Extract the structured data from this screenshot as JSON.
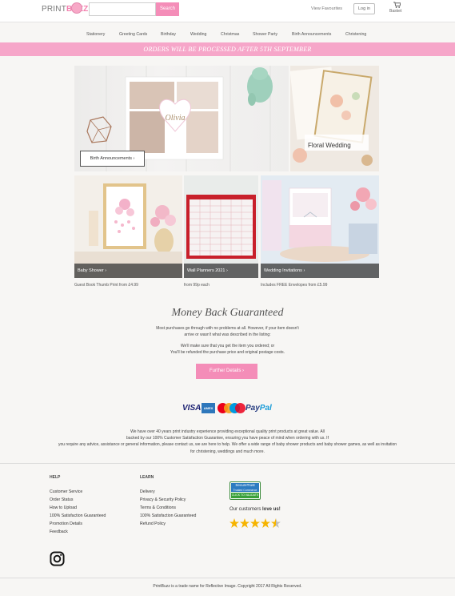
{
  "header": {
    "logo_print": "PRINT",
    "logo_buzz": "BUZZ",
    "search_placeholder": "",
    "search_button": "Search",
    "view_favourites": "View Favourites",
    "login": "Log in",
    "basket": "Basket",
    "basket_icon": "cart-icon"
  },
  "nav": {
    "items": [
      "Stationery",
      "Greeting Cards",
      "Birthday",
      "Wedding",
      "Christmas",
      "Shower Party",
      "Birth Announcements",
      "Christening"
    ]
  },
  "banner": {
    "text": "ORDERS WILL BE PROCESSED AFTER 5TH SEPTEMBER"
  },
  "tiles": {
    "birth": {
      "button": "Birth Announcements",
      "card_name": "Olivia"
    },
    "floral": {
      "label": "Floral Wedding"
    },
    "baby": {
      "label": "Baby Shower",
      "caption": "Guest Book Thumb Print from £4.99"
    },
    "wall": {
      "label": "Wall Planners 2021",
      "caption": "from 99p each"
    },
    "wedding": {
      "label": "Wedding Invitations",
      "caption": "Includes FREE Envelopes from £5.99"
    }
  },
  "money_back": {
    "title": "Money Back Guaranteed",
    "line1": "Most purchases go through with no problems at all. However, if your item doesn't",
    "line2": "arrive or wasn't what was described in the listing:",
    "line3": "We'll make sure that you get the item you ordered; or",
    "line4": "You'll be refunded the purchase price and original postage costs.",
    "button": "Further Details"
  },
  "payment": {
    "visa": "VISA",
    "amex": "AMEX",
    "paypal_pay": "Pay",
    "paypal_pal": "Pal"
  },
  "about": {
    "line1": "We have over 40 years print industry experience providing exceptional quality print products at great value. All",
    "line2": "backed by our 100% Customer Satisfaction Guarantee, ensuring you have peace of mind when ordering with us. If",
    "line3": "you require any advice, assistance or general information, please contact us, we are here to help. We offer a wide range of baby shower products and baby shower games, as well as invitation",
    "line4": "for christening, weddings and much more."
  },
  "footer": {
    "help": {
      "heading": "HELP",
      "links": [
        "Customer Service",
        "Order Status",
        "How to Upload",
        "100% Satisfaction Guaranteed",
        "Promotion Details",
        "Feedback"
      ]
    },
    "learn": {
      "heading": "LEARN",
      "links": [
        "Delivery",
        "Privacy & Security Policy",
        "Terms & Conditions",
        "100% Satisfaction Guaranteed",
        "Refund Policy"
      ]
    },
    "secure_top": "SecureTrust",
    "secure_mid": "Trusted Commerce",
    "secure_bot": "CLICK TO VALIDATE",
    "love_prefix": "Our customers ",
    "love_bold": "love us!",
    "rating": 4.5,
    "rating_max": 5,
    "copyright": "PrintBuzz is a trade name for Reflective Image. Copyright 2017 All Rights Reserved."
  },
  "colors": {
    "accent": "#f48db8",
    "banner": "#f6a6c9",
    "star": "#f6b400"
  }
}
